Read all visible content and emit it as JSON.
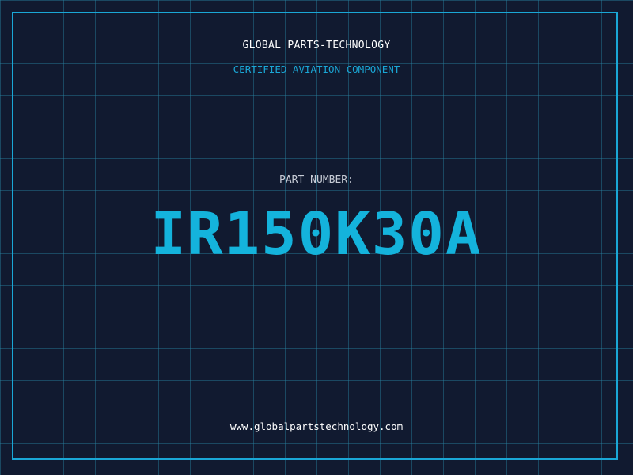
{
  "header": {
    "company": "GLOBAL PARTS-TECHNOLOGY",
    "subtitle": "CERTIFIED AVIATION COMPONENT"
  },
  "part": {
    "label": "PART NUMBER:",
    "number": "IR150K30A"
  },
  "footer": {
    "website": "www.globalpartstechnology.com"
  },
  "colors": {
    "background": "#111a30",
    "accent": "#1aa7d6",
    "grid": "#28829f",
    "text": "#ffffff"
  }
}
